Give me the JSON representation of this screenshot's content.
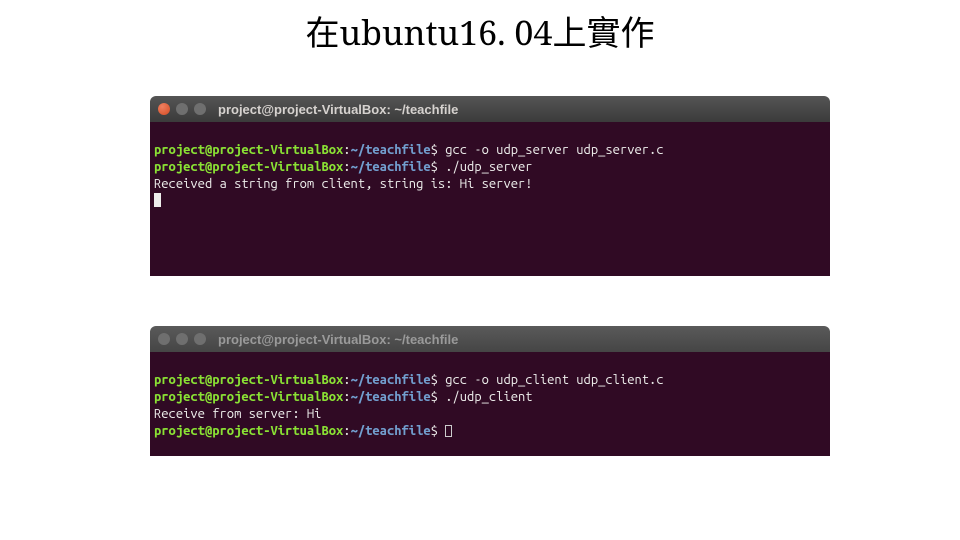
{
  "slide": {
    "title": "在ubuntu16. 04上實作"
  },
  "servers": {
    "top": {
      "titlebar": "project@project-VirtualBox: ~/teachfile",
      "lines": [
        {
          "prompt": {
            "userhost": "project@project-VirtualBox",
            "colon": ":",
            "path": "~/teachfile",
            "dollar": "$"
          },
          "command": "gcc -o udp_server udp_server.c"
        },
        {
          "prompt": {
            "userhost": "project@project-VirtualBox",
            "colon": ":",
            "path": "~/teachfile",
            "dollar": "$"
          },
          "command": "./udp_server"
        },
        {
          "output": "Received a string from client, string is: Hi server!"
        }
      ]
    },
    "bottom": {
      "titlebar": "project@project-VirtualBox: ~/teachfile",
      "lines": [
        {
          "prompt": {
            "userhost": "project@project-VirtualBox",
            "colon": ":",
            "path": "~/teachfile",
            "dollar": "$"
          },
          "command": "gcc -o udp_client udp_client.c"
        },
        {
          "prompt": {
            "userhost": "project@project-VirtualBox",
            "colon": ":",
            "path": "~/teachfile",
            "dollar": "$"
          },
          "command": "./udp_client"
        },
        {
          "output": "Receive from server: Hi"
        },
        {
          "prompt": {
            "userhost": "project@project-VirtualBox",
            "colon": ":",
            "path": "~/teachfile",
            "dollar": "$"
          },
          "command": ""
        }
      ]
    }
  }
}
